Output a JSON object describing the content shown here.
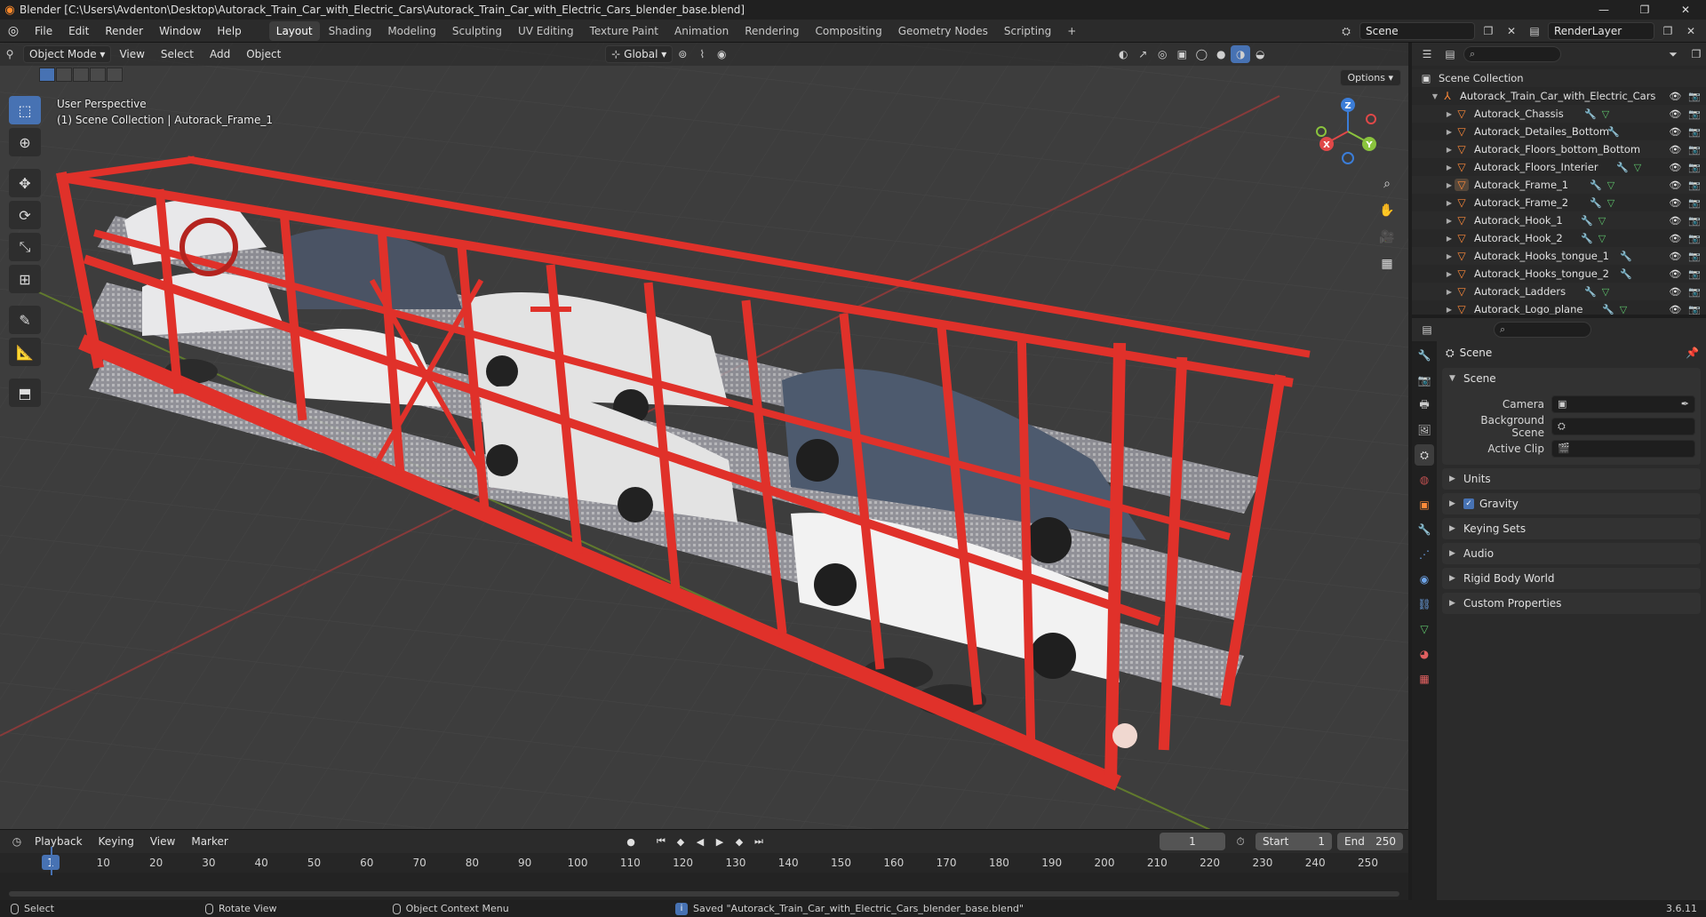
{
  "window": {
    "title": "Blender [C:\\Users\\Avdenton\\Desktop\\Autorack_Train_Car_with_Electric_Cars\\Autorack_Train_Car_with_Electric_Cars_blender_base.blend]"
  },
  "menus": [
    "File",
    "Edit",
    "Render",
    "Window",
    "Help"
  ],
  "workspaces": [
    {
      "label": "Layout",
      "active": true
    },
    {
      "label": "Shading"
    },
    {
      "label": "Modeling"
    },
    {
      "label": "Sculpting"
    },
    {
      "label": "UV Editing"
    },
    {
      "label": "Texture Paint"
    },
    {
      "label": "Animation"
    },
    {
      "label": "Rendering"
    },
    {
      "label": "Compositing"
    },
    {
      "label": "Geometry Nodes"
    },
    {
      "label": "Scripting"
    }
  ],
  "top_right": {
    "scene": "Scene",
    "view_layer": "RenderLayer"
  },
  "viewport": {
    "mode": "Object Mode",
    "menus": [
      "View",
      "Select",
      "Add",
      "Object"
    ],
    "orientation": "Global",
    "overlay_line1": "User Perspective",
    "overlay_line2": "(1) Scene Collection | Autorack_Frame_1",
    "options_label": "Options",
    "gizmo": {
      "z": "Z",
      "y": "Y",
      "x": "X"
    }
  },
  "timeline": {
    "menus": [
      "Playback",
      "Keying",
      "View",
      "Marker"
    ],
    "current_frame": "1",
    "start_label": "Start",
    "start": "1",
    "end_label": "End",
    "end": "250",
    "ticks": [
      "10",
      "20",
      "30",
      "40",
      "50",
      "60",
      "70",
      "80",
      "90",
      "100",
      "110",
      "120",
      "130",
      "140",
      "150",
      "160",
      "170",
      "180",
      "190",
      "200",
      "210",
      "220",
      "230",
      "240",
      "250"
    ]
  },
  "status": {
    "left1": "Select",
    "left2": "Rotate View",
    "left3": "Object Context Menu",
    "message": "Saved \"Autorack_Train_Car_with_Electric_Cars_blender_base.blend\"",
    "version": "3.6.11"
  },
  "outliner": {
    "root": "Scene Collection",
    "collection": "Autorack_Train_Car_with_Electric_Cars",
    "items": [
      "Autorack_Chassis",
      "Autorack_Detailes_Bottom",
      "Autorack_Floors_bottom_Bottom",
      "Autorack_Floors_Interier",
      "Autorack_Frame_1",
      "Autorack_Frame_2",
      "Autorack_Hook_1",
      "Autorack_Hook_2",
      "Autorack_Hooks_tongue_1",
      "Autorack_Hooks_tongue_2",
      "Autorack_Ladders",
      "Autorack_Logo_plane"
    ]
  },
  "properties": {
    "context": "Scene",
    "panel_scene": "Scene",
    "camera_label": "Camera",
    "background_label": "Background Scene",
    "clip_label": "Active Clip",
    "panels": [
      "Units",
      "Gravity",
      "Keying Sets",
      "Audio",
      "Rigid Body World",
      "Custom Properties"
    ]
  },
  "colors": {
    "accent": "#4772b3",
    "train_red": "#e0312a",
    "object_orange": "#ff8a3a",
    "viewport_bg": "#3d3d3d"
  }
}
